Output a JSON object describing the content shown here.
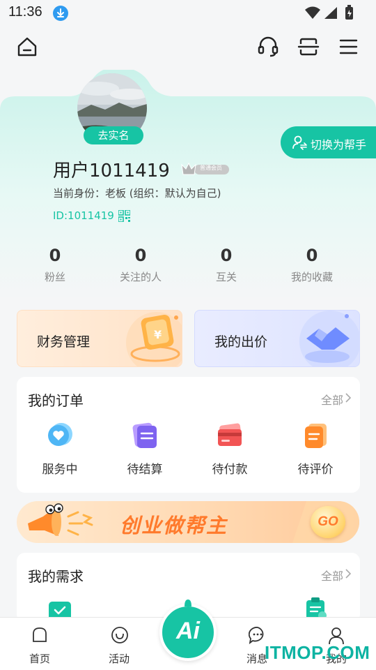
{
  "status_bar": {
    "time": "11:36"
  },
  "profile": {
    "verify_label": "去实名",
    "switch_label": "切换为帮手",
    "username": "用户1011419",
    "member_level": "普通会员",
    "identity": "当前身份：老板 (组织：默认为自己)",
    "user_id": "ID:1011419",
    "stats": [
      {
        "value": "0",
        "label": "粉丝"
      },
      {
        "value": "0",
        "label": "关注的人"
      },
      {
        "value": "0",
        "label": "互关"
      },
      {
        "value": "0",
        "label": "我的收藏"
      }
    ]
  },
  "features": [
    {
      "label": "财务管理"
    },
    {
      "label": "我的出价"
    }
  ],
  "orders": {
    "title": "我的订单",
    "all_label": "全部",
    "items": [
      {
        "label": "服务中"
      },
      {
        "label": "待结算"
      },
      {
        "label": "待付款"
      },
      {
        "label": "待评价"
      }
    ]
  },
  "banner": {
    "text": "创业做帮主",
    "button": "GO"
  },
  "needs": {
    "title": "我的需求",
    "all_label": "全部"
  },
  "tabbar": {
    "items": [
      {
        "label": "首页"
      },
      {
        "label": "活动"
      },
      {
        "label": "消息"
      },
      {
        "label": "我的"
      }
    ],
    "ai_label": "Ai"
  },
  "watermark": "ITMOP.COM",
  "colors": {
    "accent": "#17c4a4",
    "accent_light": "#d9f7f1"
  }
}
